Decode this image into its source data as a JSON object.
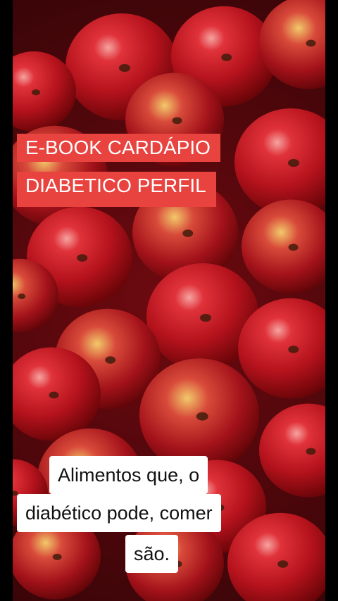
{
  "overlay_title": {
    "line1": "E-BOOK CARDÁPIO",
    "line2": "DIABETICO PERFIL",
    "background": "#e8433f"
  },
  "caption": {
    "line1": "Alimentos que, o",
    "line2": "diabético pode, comer",
    "line3": "são."
  },
  "colors": {
    "apple_light": "#e0323a",
    "apple_mid": "#b4121c",
    "apple_dark": "#6a0508"
  }
}
